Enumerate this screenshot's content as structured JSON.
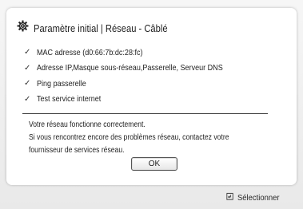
{
  "dialog": {
    "title": "Paramètre initial | Réseau - Câblé",
    "title_icon": "gear-icon",
    "checks": [
      {
        "label": "MAC adresse (d0:66:7b:dc:28:fc)",
        "status": "checked"
      },
      {
        "label": "Adresse IP,Masque sous-réseau,Passerelle, Serveur DNS",
        "status": "checked"
      },
      {
        "label": "Ping passerelle",
        "status": "checked"
      },
      {
        "label": "Test service internet",
        "status": "checked"
      }
    ],
    "message_lines": [
      "Votre réseau fonctionne correctement.",
      "Si vous rencontrez encore des problèmes réseau, contactez votre",
      "fournisseur de services réseau."
    ],
    "ok_label": "OK"
  },
  "footer": {
    "select_icon": "enter-icon",
    "select_label": "Sélectionner"
  }
}
